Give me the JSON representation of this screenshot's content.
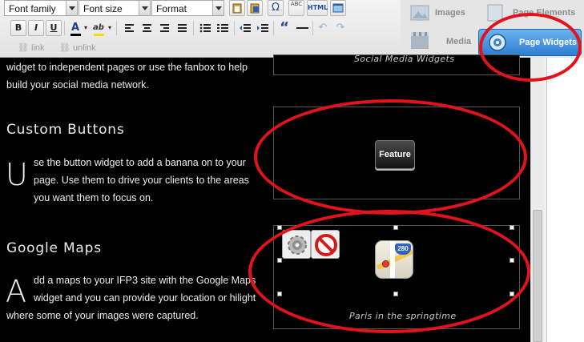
{
  "toolbar": {
    "font_family": "Font family",
    "font_size": "Font size",
    "format": "Format",
    "bold": "B",
    "italic": "I",
    "underline": "U",
    "font_color": "A",
    "highlight": "ab",
    "omega": "Ω",
    "abc": "ABC",
    "html": "HTML",
    "quote": "“",
    "link": "link",
    "unlink": "unlink"
  },
  "panel": {
    "images": "Images",
    "page_elements": "Page Elements",
    "media": "Media",
    "page_widgets": "Page Widgets",
    "accent_color": "#2e7ed1"
  },
  "content": {
    "intro_line1": "widget to independent pages or use the fanbox to help",
    "intro_line2": "build your social media network.",
    "social_caption": "Social Media Widgets",
    "custom_buttons": {
      "heading": "Custom Buttons",
      "dropcap": "U",
      "line1": "se the button widget to add a banana on to your",
      "line2": "page. Use them to drive your clients to the areas",
      "line3": "you want them to focus on.",
      "feature_label": "Feature"
    },
    "google_maps": {
      "heading": "Google Maps",
      "dropcap": "A",
      "line1": "dd a maps to your IFP3 site with the Google Maps",
      "line2": "widget and you can provide your location or hilight",
      "line3": "where some of your images were captured.",
      "caption": "Paris in the springtime",
      "map_badge": "280"
    }
  },
  "annotation_color": "#e3121b"
}
